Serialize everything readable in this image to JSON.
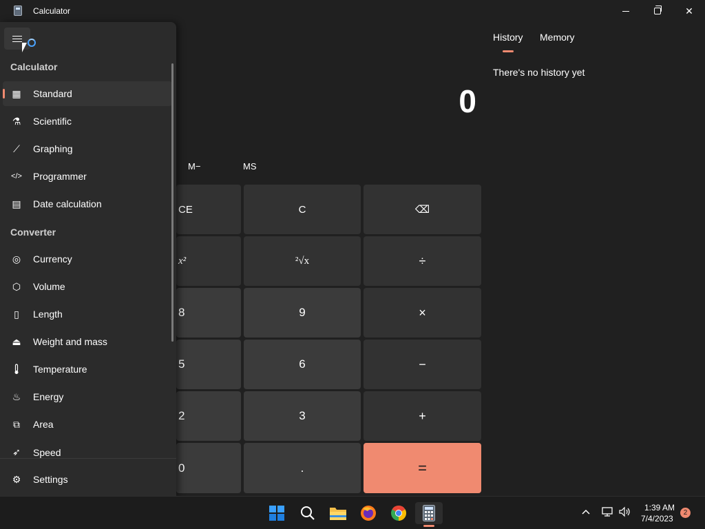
{
  "window": {
    "title": "Calculator",
    "minimize_icon": "minimize-icon",
    "maximize_icon": "restore-icon",
    "close_icon": "close-icon",
    "close_glyph": "✕"
  },
  "nav": {
    "menu_icon": "hamburger-menu-icon",
    "calculator_heading": "Calculator",
    "calculator_items": [
      {
        "label": "Standard",
        "icon": "calculator-icon",
        "glyph": "▦",
        "selected": true
      },
      {
        "label": "Scientific",
        "icon": "flask-icon",
        "glyph": "⚗"
      },
      {
        "label": "Graphing",
        "icon": "graph-icon",
        "glyph": "⟋"
      },
      {
        "label": "Programmer",
        "icon": "code-icon",
        "glyph": "</>"
      },
      {
        "label": "Date calculation",
        "icon": "calendar-icon",
        "glyph": "▤"
      }
    ],
    "converter_heading": "Converter",
    "converter_items": [
      {
        "label": "Currency",
        "icon": "currency-icon",
        "glyph": "◎"
      },
      {
        "label": "Volume",
        "icon": "cube-icon",
        "glyph": "⬡"
      },
      {
        "label": "Length",
        "icon": "ruler-icon",
        "glyph": "▯"
      },
      {
        "label": "Weight and mass",
        "icon": "weight-icon",
        "glyph": "⏏"
      },
      {
        "label": "Temperature",
        "icon": "thermometer-icon",
        "glyph": "🌡"
      },
      {
        "label": "Energy",
        "icon": "flame-icon",
        "glyph": "♨"
      },
      {
        "label": "Area",
        "icon": "area-icon",
        "glyph": "⧉"
      },
      {
        "label": "Speed",
        "icon": "speed-icon",
        "glyph": "➶"
      }
    ],
    "settings": {
      "label": "Settings",
      "icon": "gear-icon",
      "glyph": "⚙"
    }
  },
  "display": {
    "value": "0"
  },
  "memory": {
    "m_minus": "M−",
    "ms": "MS"
  },
  "keypad": {
    "ce": "CE",
    "c": "C",
    "backspace": "⌫",
    "square": "x²",
    "sqrt": "²√x",
    "divide": "÷",
    "eight": "8",
    "nine": "9",
    "multiply": "×",
    "five": "5",
    "six": "6",
    "minus": "−",
    "two": "2",
    "three": "3",
    "plus": "+",
    "zero": "0",
    "decimal": ".",
    "equals": "="
  },
  "history": {
    "tab_history": "History",
    "tab_memory": "Memory",
    "empty_message": "There's no history yet"
  },
  "taskbar": {
    "apps": [
      {
        "name": "start-menu-icon"
      },
      {
        "name": "search-icon"
      },
      {
        "name": "file-explorer-icon"
      },
      {
        "name": "firefox-icon"
      },
      {
        "name": "chrome-icon"
      },
      {
        "name": "calculator-app-icon",
        "active": true
      }
    ],
    "tray": {
      "chevron_glyph": "^",
      "network_icon": "network-icon",
      "volume_icon": "volume-icon",
      "time": "1:39 AM",
      "date": "7/4/2023",
      "notifications": "2"
    }
  },
  "colors": {
    "accent": "#f08a70",
    "background": "#202020",
    "nav_pane": "#2b2b2b",
    "button": "#3b3b3b"
  }
}
